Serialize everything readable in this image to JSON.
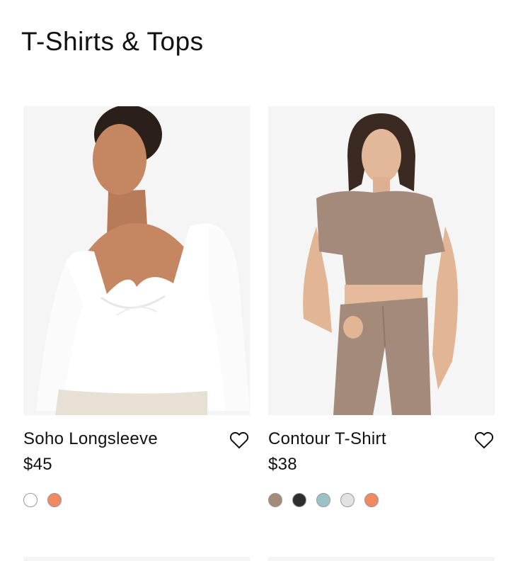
{
  "page": {
    "title": "T-Shirts & Tops"
  },
  "products": [
    {
      "name": "Soho Longsleeve",
      "price": "$45",
      "swatches": [
        "#ffffff",
        "#f08a63"
      ]
    },
    {
      "name": "Contour T-Shirt",
      "price": "$38",
      "swatches": [
        "#a48a7b",
        "#2e2e30",
        "#9bc3c7",
        "#dfe3e6",
        "#f08a63"
      ]
    }
  ],
  "icons": {
    "wishlist": "heart-outline-icon"
  }
}
